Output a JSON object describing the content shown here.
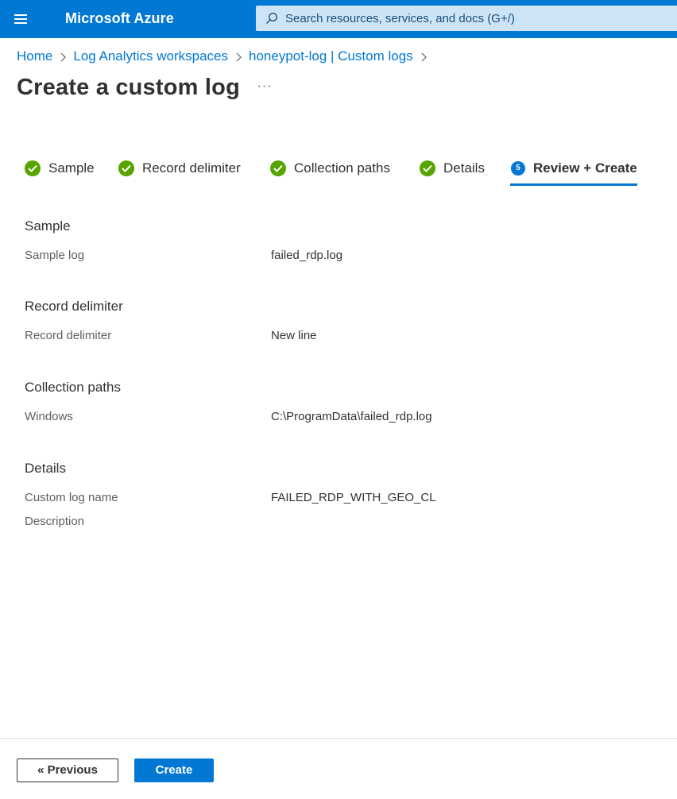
{
  "topbar": {
    "brand": "Microsoft Azure",
    "search_placeholder": "Search resources, services, and docs (G+/)",
    "accent_color": "#0078d4"
  },
  "breadcrumb": [
    "Home",
    "Log Analytics workspaces",
    "honeypot-log | Custom logs"
  ],
  "page": {
    "title": "Create a custom log",
    "more": "···"
  },
  "steps": [
    {
      "label": "Sample",
      "state": "completed"
    },
    {
      "label": "Record delimiter",
      "state": "completed"
    },
    {
      "label": "Collection paths",
      "state": "completed"
    },
    {
      "label": "Details",
      "state": "completed"
    },
    {
      "label": "Review + Create",
      "state": "active",
      "number": "5"
    }
  ],
  "review": {
    "sample": {
      "title": "Sample",
      "fields": [
        {
          "label": "Sample log",
          "value": "failed_rdp.log"
        }
      ]
    },
    "record_delimiter": {
      "title": "Record delimiter",
      "fields": [
        {
          "label": "Record delimiter",
          "value": "New line"
        }
      ]
    },
    "collection_paths": {
      "title": "Collection paths",
      "fields": [
        {
          "label": "Windows",
          "value": "C:\\ProgramData\\failed_rdp.log"
        }
      ]
    },
    "details": {
      "title": "Details",
      "fields": [
        {
          "label": "Custom log name",
          "value": "FAILED_RDP_WITH_GEO_CL"
        },
        {
          "label": "Description",
          "value": ""
        }
      ]
    }
  },
  "footer": {
    "previous_label": "« Previous",
    "create_label": "Create"
  },
  "colors": {
    "success": "#57a300",
    "primary": "#0078d4"
  }
}
